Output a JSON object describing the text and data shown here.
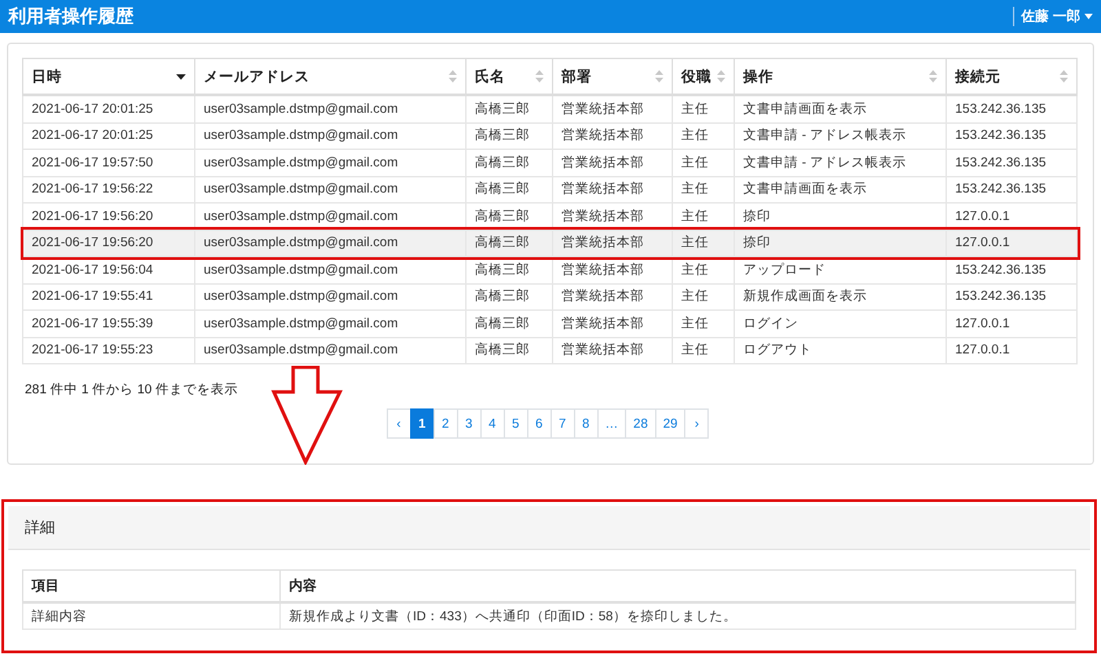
{
  "header": {
    "title": "利用者操作履歴",
    "user": "佐藤 一郎"
  },
  "table": {
    "columns": [
      {
        "label": "日時",
        "sorted": true
      },
      {
        "label": "メールアドレス",
        "sorted": false
      },
      {
        "label": "氏名",
        "sorted": false
      },
      {
        "label": "部署",
        "sorted": false
      },
      {
        "label": "役職",
        "sorted": false
      },
      {
        "label": "操作",
        "sorted": false
      },
      {
        "label": "接続元",
        "sorted": false
      }
    ],
    "rows": [
      {
        "selected": false,
        "cells": [
          "2021-06-17 20:01:25",
          "user03sample.dstmp@gmail.com",
          "高橋三郎",
          "営業統括本部",
          "主任",
          "文書申請画面を表示",
          "153.242.36.135"
        ]
      },
      {
        "selected": false,
        "cells": [
          "2021-06-17 20:01:25",
          "user03sample.dstmp@gmail.com",
          "高橋三郎",
          "営業統括本部",
          "主任",
          "文書申請 - アドレス帳表示",
          "153.242.36.135"
        ]
      },
      {
        "selected": false,
        "cells": [
          "2021-06-17 19:57:50",
          "user03sample.dstmp@gmail.com",
          "高橋三郎",
          "営業統括本部",
          "主任",
          "文書申請 - アドレス帳表示",
          "153.242.36.135"
        ]
      },
      {
        "selected": false,
        "cells": [
          "2021-06-17 19:56:22",
          "user03sample.dstmp@gmail.com",
          "高橋三郎",
          "営業統括本部",
          "主任",
          "文書申請画面を表示",
          "153.242.36.135"
        ]
      },
      {
        "selected": false,
        "cells": [
          "2021-06-17 19:56:20",
          "user03sample.dstmp@gmail.com",
          "高橋三郎",
          "営業統括本部",
          "主任",
          "捺印",
          "127.0.0.1"
        ]
      },
      {
        "selected": true,
        "cells": [
          "2021-06-17 19:56:20",
          "user03sample.dstmp@gmail.com",
          "高橋三郎",
          "営業統括本部",
          "主任",
          "捺印",
          "127.0.0.1"
        ]
      },
      {
        "selected": false,
        "cells": [
          "2021-06-17 19:56:04",
          "user03sample.dstmp@gmail.com",
          "高橋三郎",
          "営業統括本部",
          "主任",
          "アップロード",
          "153.242.36.135"
        ]
      },
      {
        "selected": false,
        "cells": [
          "2021-06-17 19:55:41",
          "user03sample.dstmp@gmail.com",
          "高橋三郎",
          "営業統括本部",
          "主任",
          "新規作成画面を表示",
          "153.242.36.135"
        ]
      },
      {
        "selected": false,
        "cells": [
          "2021-06-17 19:55:39",
          "user03sample.dstmp@gmail.com",
          "高橋三郎",
          "営業統括本部",
          "主任",
          "ログイン",
          "127.0.0.1"
        ]
      },
      {
        "selected": false,
        "cells": [
          "2021-06-17 19:55:23",
          "user03sample.dstmp@gmail.com",
          "高橋三郎",
          "営業統括本部",
          "主任",
          "ログアウト",
          "127.0.0.1"
        ]
      }
    ]
  },
  "summary": "281 件中 1 件から 10 件までを表示",
  "pagination": {
    "prev": "‹",
    "next": "›",
    "pages": [
      {
        "label": "1",
        "selected": true
      },
      {
        "label": "2",
        "selected": false
      },
      {
        "label": "3",
        "selected": false
      },
      {
        "label": "4",
        "selected": false
      },
      {
        "label": "5",
        "selected": false
      },
      {
        "label": "6",
        "selected": false
      },
      {
        "label": "7",
        "selected": false
      },
      {
        "label": "8",
        "selected": false
      },
      {
        "label": "…",
        "selected": false
      },
      {
        "label": "28",
        "selected": false
      },
      {
        "label": "29",
        "selected": false
      }
    ]
  },
  "detail": {
    "title": "詳細",
    "columns": [
      "項目",
      "内容"
    ],
    "rows": [
      [
        "詳細内容",
        "新規作成より文書（ID：433）へ共通印（印面ID：58）を捺印しました。"
      ]
    ]
  }
}
